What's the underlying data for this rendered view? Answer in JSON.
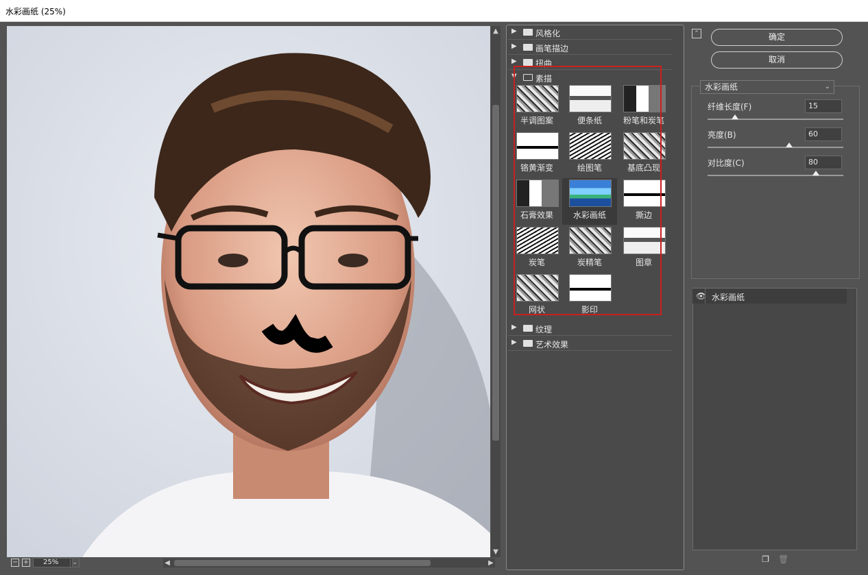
{
  "window": {
    "title": "水彩画纸 (25%)"
  },
  "preview": {
    "zoom": "25%"
  },
  "gallery": {
    "folders_top": [
      {
        "label": "风格化",
        "expanded": false
      },
      {
        "label": "画笔描边",
        "expanded": false
      },
      {
        "label": "扭曲",
        "expanded": false
      }
    ],
    "open_folder": {
      "label": "素描",
      "expanded": true
    },
    "thumbnails": [
      {
        "label": "半调图案"
      },
      {
        "label": "便条纸"
      },
      {
        "label": "粉笔和炭笔"
      },
      {
        "label": "铬黄渐变"
      },
      {
        "label": "绘图笔"
      },
      {
        "label": "基底凸现"
      },
      {
        "label": "石膏效果"
      },
      {
        "label": "水彩画纸",
        "selected": true
      },
      {
        "label": "撕边"
      },
      {
        "label": "炭笔"
      },
      {
        "label": "炭精笔"
      },
      {
        "label": "图章"
      },
      {
        "label": "网状"
      },
      {
        "label": "影印"
      }
    ],
    "folders_bottom": [
      {
        "label": "纹理",
        "expanded": false
      },
      {
        "label": "艺术效果",
        "expanded": false
      }
    ]
  },
  "buttons": {
    "ok": "确定",
    "cancel": "取消"
  },
  "settings": {
    "filter": "水彩画纸",
    "params": [
      {
        "label": "纤维长度(F)",
        "value": "15",
        "fraction": 0.2
      },
      {
        "label": "亮度(B)",
        "value": "60",
        "fraction": 0.6
      },
      {
        "label": "对比度(C)",
        "value": "80",
        "fraction": 0.8
      }
    ]
  },
  "layers": {
    "items": [
      {
        "label": "水彩画纸"
      }
    ]
  },
  "colors": {
    "highlight": "#cc1f1f",
    "panel": "#535353"
  }
}
